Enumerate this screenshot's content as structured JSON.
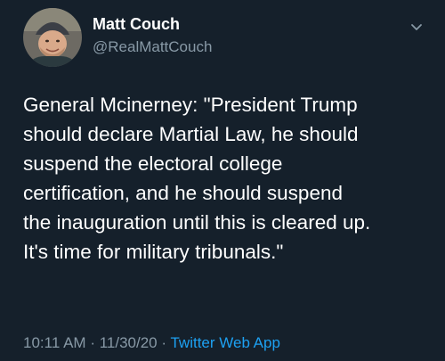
{
  "tweet": {
    "display_name": "Matt Couch",
    "handle": "@RealMattCouch",
    "text": "General Mcinerney: \"President Trump\nshould declare Martial Law, he should\nsuspend the electoral college\ncertification, and he should suspend\nthe inauguration until this is cleared up.\nIt's time for military tribunals.\"",
    "time": "10:11 AM",
    "date": "11/30/20",
    "separator": "·",
    "source_app": "Twitter Web App"
  },
  "icons": {
    "more": "chevron-down-icon",
    "avatar": "avatar"
  },
  "colors": {
    "background": "#15202b",
    "primary_text": "#ffffff",
    "secondary_text": "#8899a6",
    "link": "#1da1f2"
  }
}
